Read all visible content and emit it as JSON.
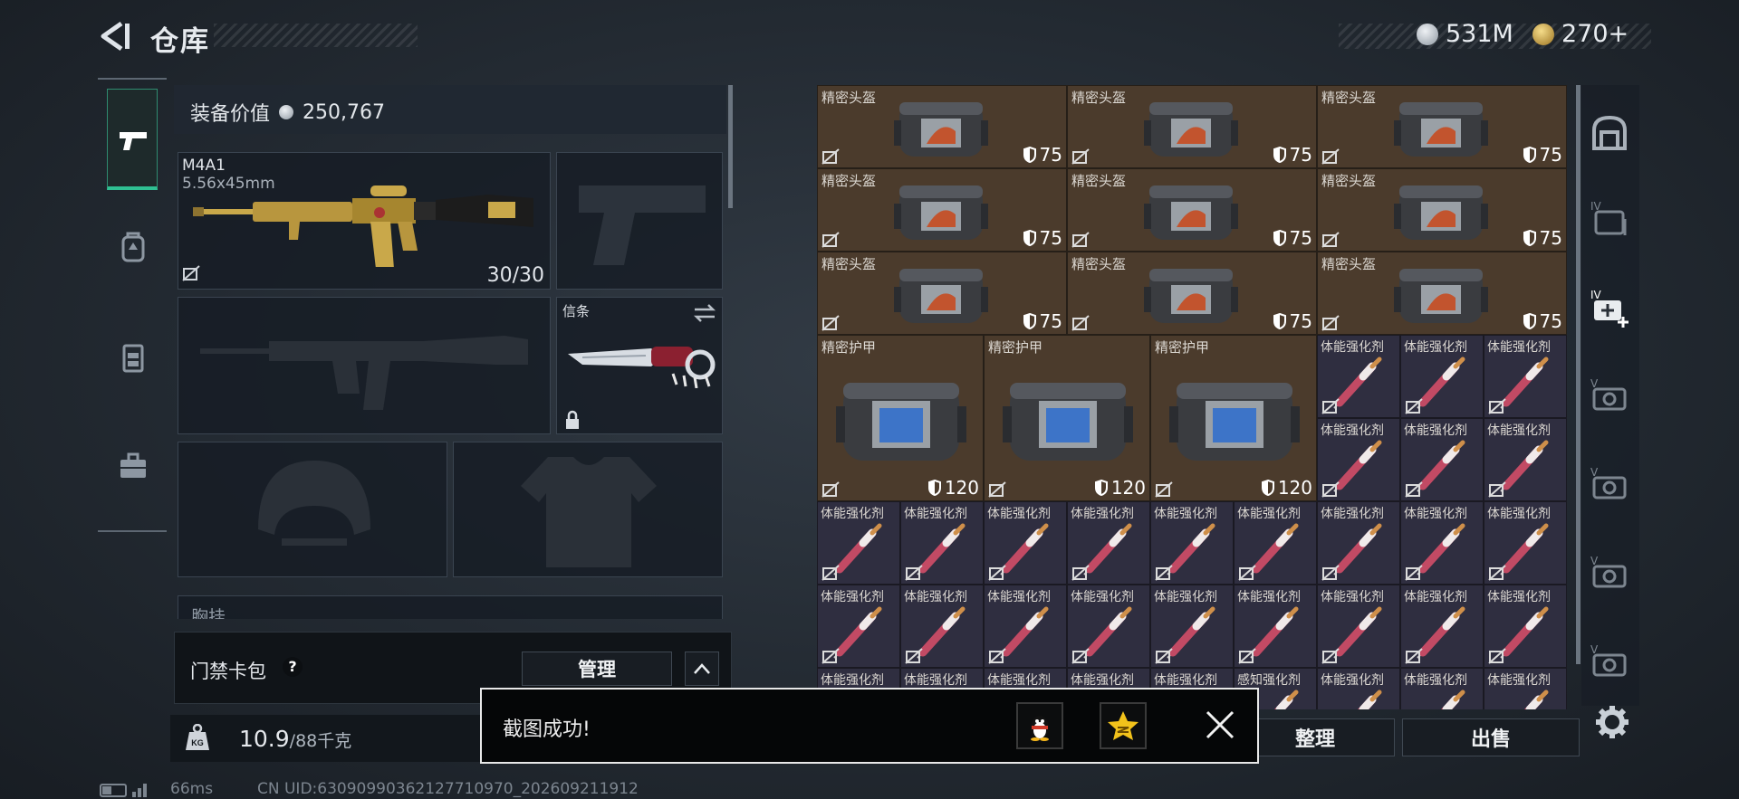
{
  "header": {
    "title": "仓库",
    "currency_silver": "531M",
    "currency_gold": "270+",
    "colors": {
      "silver_coin": "#b9c0c8",
      "gold_coin": "#c9a34a"
    }
  },
  "loadout": {
    "value_label": "装备价值",
    "value": "250,767",
    "primary": {
      "name": "M4A1",
      "caliber": "5.56x45mm",
      "ammo": "30/30"
    },
    "melee_label": "信条",
    "chest_rig_label": "胸挂",
    "card_pack_label": "门禁卡包",
    "help_mark": "?",
    "manage_label": "管理",
    "weight_value": "10.9",
    "weight_capacity": "/88千克"
  },
  "inventory": {
    "helmet_name": "精密头盔",
    "helmet_durability": "75",
    "armor_name": "精密护甲",
    "armor_durability": "120",
    "stim_name": "体能强化剂",
    "stim_alt_name": "感知强化剂"
  },
  "actions": {
    "sort_label": "整理",
    "sell_label": "出售"
  },
  "toast": {
    "message": "截图成功!"
  },
  "status": {
    "ping": "66ms",
    "uid": "CN UID:6309099036212771097​0_202609211912"
  }
}
